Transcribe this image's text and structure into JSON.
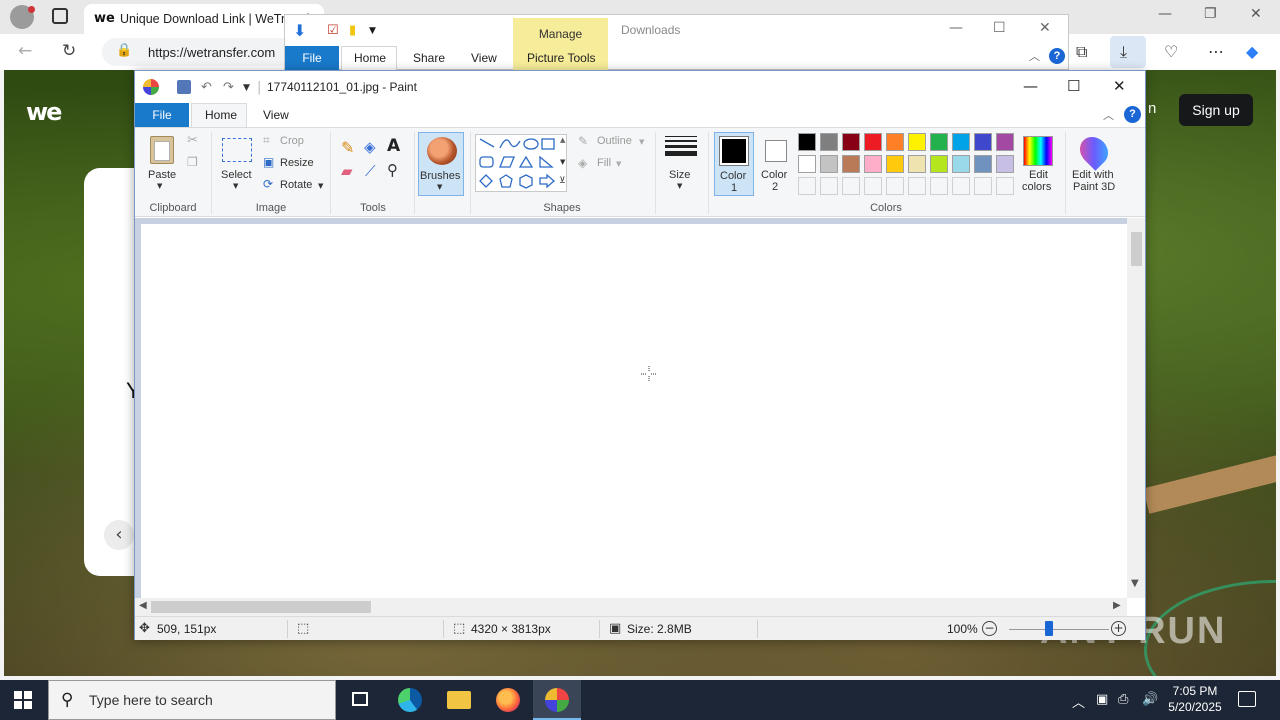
{
  "browser": {
    "tab_title": "Unique Download Link | WeTransfer",
    "tab_favicon": "we",
    "url": "https://wetransfer.com",
    "accent_color": "#dbe7f5"
  },
  "website": {
    "logo": "we",
    "signin_fragment": "n",
    "signup_label": "Sign up",
    "card_fragment": "Y"
  },
  "explorer": {
    "title": "Downloads",
    "context_tab": "Manage",
    "tabs": [
      "File",
      "Home",
      "Share",
      "View",
      "Picture Tools"
    ],
    "context_color": "#f6ec9a"
  },
  "paint": {
    "title": "17740112101_01.jpg - Paint",
    "tabs": [
      "File",
      "Home",
      "View"
    ],
    "ribbon": {
      "clipboard": {
        "paste": "Paste",
        "group": "Clipboard"
      },
      "image": {
        "select": "Select",
        "crop": "Crop",
        "resize": "Resize",
        "rotate": "Rotate",
        "group": "Image"
      },
      "tools": {
        "group": "Tools"
      },
      "brushes": "Brushes",
      "shapes": {
        "outline": "Outline",
        "fill": "Fill",
        "group": "Shapes"
      },
      "size": "Size",
      "color1": [
        "Color",
        "1"
      ],
      "color2": [
        "Color",
        "2"
      ],
      "colors_group": "Colors",
      "edit_colors": [
        "Edit",
        "colors"
      ],
      "edit_3d": [
        "Edit with",
        "Paint 3D"
      ]
    },
    "palette_row1": [
      "#000000",
      "#7f7f7f",
      "#880015",
      "#ed1c24",
      "#ff7f27",
      "#fff200",
      "#22b14c",
      "#00a2e8",
      "#3f48cc",
      "#a349a4"
    ],
    "palette_row2": [
      "#ffffff",
      "#c3c3c3",
      "#b97a57",
      "#ffaec9",
      "#ffc90e",
      "#efe4b0",
      "#b5e61d",
      "#99d9ea",
      "#7092be",
      "#c8bfe7"
    ],
    "palette_empty_count": 10,
    "status": {
      "cursor_pos": "509, 151px",
      "image_dims": "4320 × 3813px",
      "file_size": "Size: 2.8MB",
      "zoom": "100%"
    }
  },
  "watermark": "ANY RUN",
  "taskbar": {
    "search_placeholder": "Type here to search",
    "time": "7:05 PM",
    "date": "5/20/2025"
  }
}
